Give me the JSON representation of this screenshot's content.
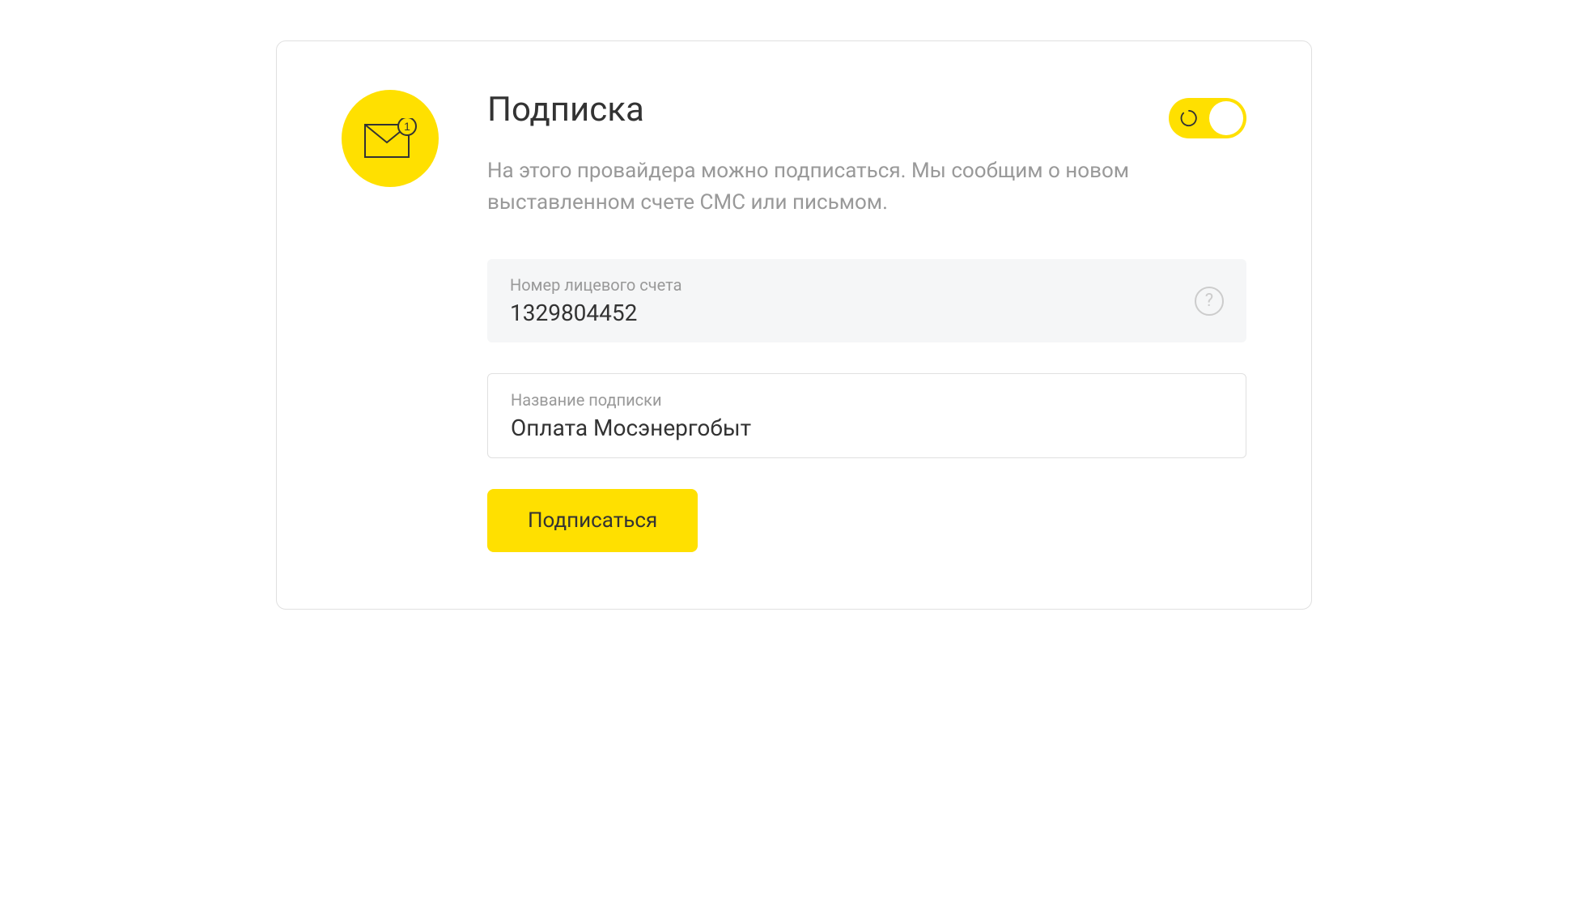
{
  "card": {
    "title": "Подписка",
    "description": "На этого провайдера можно подписаться. Мы сообщим о новом выставленном счете СМС или письмом.",
    "toggle_on": true
  },
  "fields": {
    "account": {
      "label": "Номер лицевого счета",
      "value": "1329804452"
    },
    "subscription_name": {
      "label": "Название подписки",
      "value": "Оплата Мосэнергобыт"
    }
  },
  "actions": {
    "subscribe_label": "Подписаться"
  },
  "colors": {
    "accent": "#ffe000",
    "text_primary": "#333333",
    "text_secondary": "#999999",
    "border": "#e0e0e0",
    "field_bg": "#f5f6f7"
  }
}
